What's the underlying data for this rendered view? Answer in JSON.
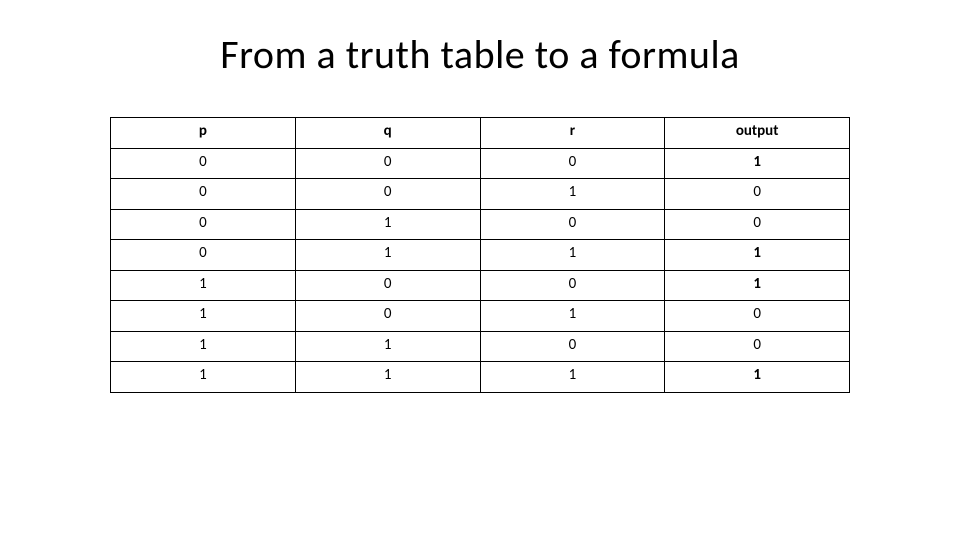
{
  "title": "From a truth table to a formula",
  "chart_data": {
    "type": "table",
    "headers": [
      "p",
      "q",
      "r",
      "output"
    ],
    "rows": [
      [
        "0",
        "0",
        "0",
        "1"
      ],
      [
        "0",
        "0",
        "1",
        "0"
      ],
      [
        "0",
        "1",
        "0",
        "0"
      ],
      [
        "0",
        "1",
        "1",
        "1"
      ],
      [
        "1",
        "0",
        "0",
        "1"
      ],
      [
        "1",
        "0",
        "1",
        "0"
      ],
      [
        "1",
        "1",
        "0",
        "0"
      ],
      [
        "1",
        "1",
        "1",
        "1"
      ]
    ]
  }
}
